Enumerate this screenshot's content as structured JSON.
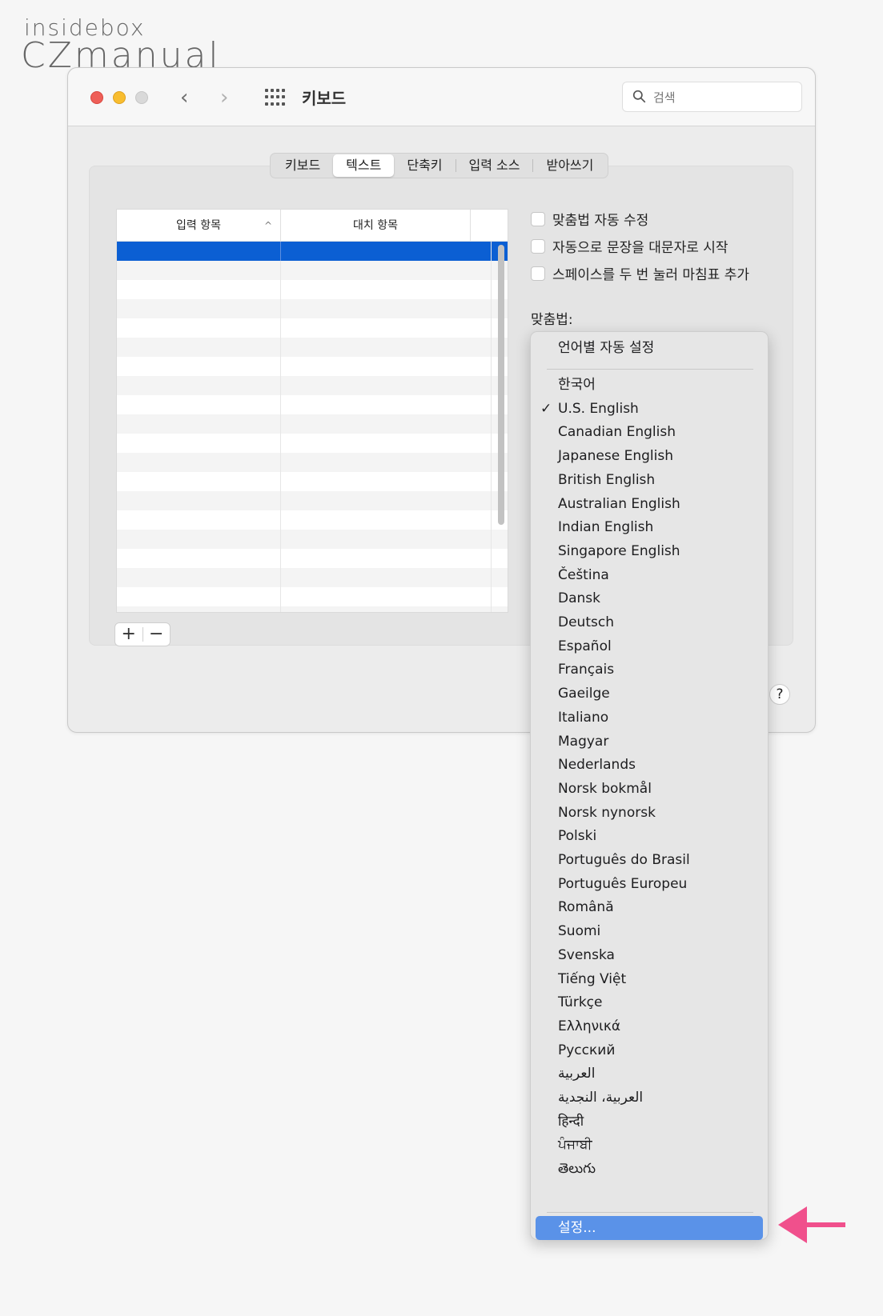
{
  "watermark": {
    "top": "insidebox",
    "bottom": "CZmanual"
  },
  "window": {
    "title": "키보드",
    "search_placeholder": "검색",
    "tabs": [
      {
        "label": "키보드",
        "active": false
      },
      {
        "label": "텍스트",
        "active": true
      },
      {
        "label": "단축키",
        "active": false
      },
      {
        "label": "입력 소스",
        "active": false
      },
      {
        "label": "받아쓰기",
        "active": false
      }
    ]
  },
  "table": {
    "columns": [
      "입력 항목",
      "대치 항목"
    ],
    "sort_indicator": "^"
  },
  "buttons": {
    "add": "+",
    "remove": "−",
    "help": "?"
  },
  "options": [
    {
      "label": "맞춤법 자동 수정",
      "checked": false
    },
    {
      "label": "자동으로 문장을 대문자로 시작",
      "checked": false
    },
    {
      "label": "스페이스를 두 번 눌러 마침표 추가",
      "checked": false
    }
  ],
  "spelling": {
    "label": "맞춤법:",
    "menu_top": "언어별 자동 설정",
    "languages": [
      "한국어",
      "U.S. English",
      "Canadian English",
      "Japanese English",
      "British English",
      "Australian English",
      "Indian English",
      "Singapore English",
      "Čeština",
      "Dansk",
      "Deutsch",
      "Español",
      "Français",
      "Gaeilge",
      "Italiano",
      "Magyar",
      "Nederlands",
      "Norsk bokmål",
      "Norsk nynorsk",
      "Polski",
      "Português do Brasil",
      "Português Europeu",
      "Română",
      "Suomi",
      "Svenska",
      "Tiếng Việt",
      "Türkçe",
      "Ελληνικά",
      "Русский",
      "العربية",
      "العربية، النجدية",
      "हिन्दी",
      "ਪੰਜਾਬੀ",
      "తెలుగు"
    ],
    "selected": "U.S. English",
    "check_mark": "✓",
    "setup": "설정..."
  },
  "colors": {
    "selection": "#0b5fd3",
    "menu_highlight": "#5a92e8",
    "arrow": "#f0508c"
  }
}
